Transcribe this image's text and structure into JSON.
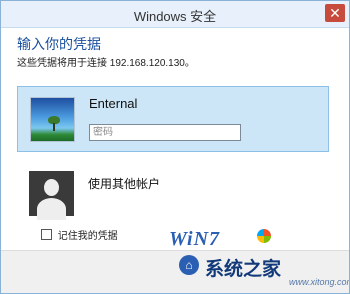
{
  "window": {
    "title": "Windows 安全"
  },
  "dialog": {
    "heading": "输入你的凭据",
    "subheading": "这些凭据将用于连接 192.168.120.130。"
  },
  "accounts": [
    {
      "name": "Enternal",
      "password_placeholder": "密码",
      "avatar_icon": "landscape-photo-icon"
    },
    {
      "name": "使用其他帐户",
      "avatar_icon": "generic-user-icon"
    }
  ],
  "remember": {
    "label": "记住我的凭据",
    "checked": false
  },
  "watermark": {
    "logo": "WiN7",
    "brand": "系统之家",
    "url": "www.xitong.com"
  },
  "colors": {
    "accent": "#1a4fa0",
    "selection": "#cce6f7",
    "close": "#c64b3c"
  }
}
